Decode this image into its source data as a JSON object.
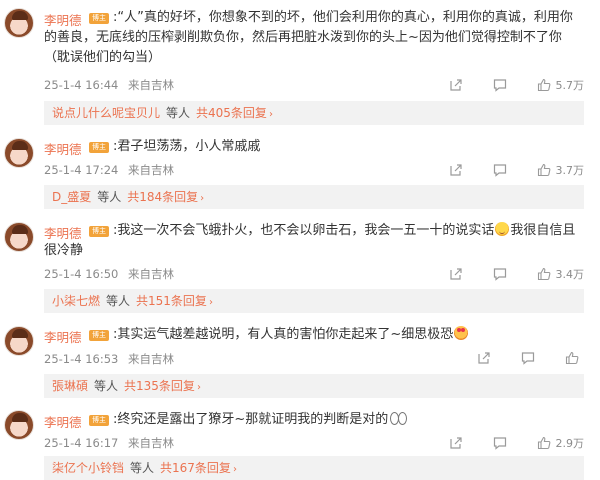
{
  "comments": [
    {
      "username": "李明德",
      "badge": "博主",
      "text": ":“人”真的好坏，你想象不到的坏，他们会利用你的真心，利用你的真诚，利用你的善良，无底线的压榨剥削欺负你，然后再把脏水泼到你的头上~因为他们觉得控制不了你（耽误他们的勾当）",
      "date": "25-1-4 16:44",
      "source": "来自吉林",
      "likes": "5.7万",
      "reply_user": "说点儿什么呢宝贝儿",
      "reply_mid": "等人",
      "reply_count": "共405条回复"
    },
    {
      "username": "李明德",
      "badge": "博主",
      "text": ":君子坦荡荡，小人常戚戚",
      "date": "25-1-4 17:24",
      "source": "来自吉林",
      "likes": "3.7万",
      "reply_user": "D_盛夏",
      "reply_mid": "等人",
      "reply_count": "共184条回复"
    },
    {
      "username": "李明德",
      "badge": "博主",
      "text_a": ":我这一次不会飞蛾扑火，也不会以卵击石，我会一五一十的说实话",
      "text_b": "我很自信且很冷静",
      "date": "25-1-4 16:50",
      "source": "来自吉林",
      "likes": "3.4万",
      "reply_user": "小柒七燃",
      "reply_mid": "等人",
      "reply_count": "共151条回复"
    },
    {
      "username": "李明德",
      "badge": "博主",
      "text": ":其实运气越差越说明，有人真的害怕你走起来了~细思极恐",
      "date": "25-1-4 16:53",
      "source": "来自吉林",
      "likes": "",
      "reply_user": "張琳碩",
      "reply_mid": "等人",
      "reply_count": "共135条回复"
    },
    {
      "username": "李明德",
      "badge": "博主",
      "text": ":终究还是露出了獠牙~那就证明我的判断是对的",
      "date": "25-1-4 16:17",
      "source": "来自吉林",
      "likes": "2.9万",
      "reply_user": "柒亿个小铃铛",
      "reply_mid": "等人",
      "reply_count": "共167条回复"
    }
  ],
  "icons": {
    "share": "share-icon",
    "comment": "comment-icon",
    "like": "like-icon",
    "arrow": "chevron-right-icon"
  },
  "reply_arrow": "›",
  "colors": {
    "username": "#eb7350",
    "badge": "#f2a33a",
    "meta": "#8a8a8a",
    "reply_bg": "#f2f2f2"
  }
}
